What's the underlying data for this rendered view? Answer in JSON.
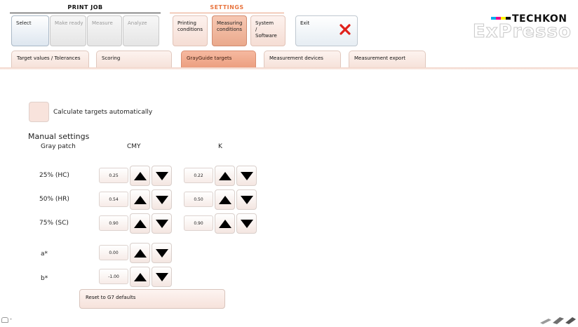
{
  "header": {
    "print_job_title": "PRINT JOB",
    "settings_title": "SETTINGS",
    "buttons": {
      "select": "Select",
      "make_ready": "Make ready",
      "measure": "Measure",
      "analyze": "Analyze",
      "printing_conditions": "Printing conditions",
      "measuring_conditions": "Measuring conditions",
      "system_software": "System / Software",
      "exit": "Exit"
    },
    "brand": {
      "company": "TECHKON",
      "product": "ExPresso"
    }
  },
  "tabs": [
    {
      "label": "Target values / Tolerances",
      "active": false
    },
    {
      "label": "Scoring",
      "active": false
    },
    {
      "label": "GrayGuide targets",
      "active": true
    },
    {
      "label": "Measurement devices",
      "active": false
    },
    {
      "label": "Measurement export",
      "active": false
    }
  ],
  "main": {
    "auto_checkbox_label": "Calculate targets automatically",
    "manual_title": "Manual settings",
    "col_gray": "Gray patch",
    "col_cmy": "CMY",
    "col_k": "K",
    "rows": [
      {
        "label": "25% (HC)",
        "cmy": "0.25",
        "k": "0.22"
      },
      {
        "label": "50% (HR)",
        "cmy": "0.54",
        "k": "0.50"
      },
      {
        "label": "75% (SC)",
        "cmy": "0.90",
        "k": "0.90"
      }
    ],
    "a_label": "a*",
    "a_value": "0.00",
    "b_label": "b*",
    "b_value": "-1.00",
    "reset_button": "Reset to G7 defaults"
  },
  "footer": {
    "status": "-"
  },
  "colors": {
    "accent": "#ec9f80",
    "exit_x": "#e0201a",
    "settings_title": "#e8743e"
  }
}
